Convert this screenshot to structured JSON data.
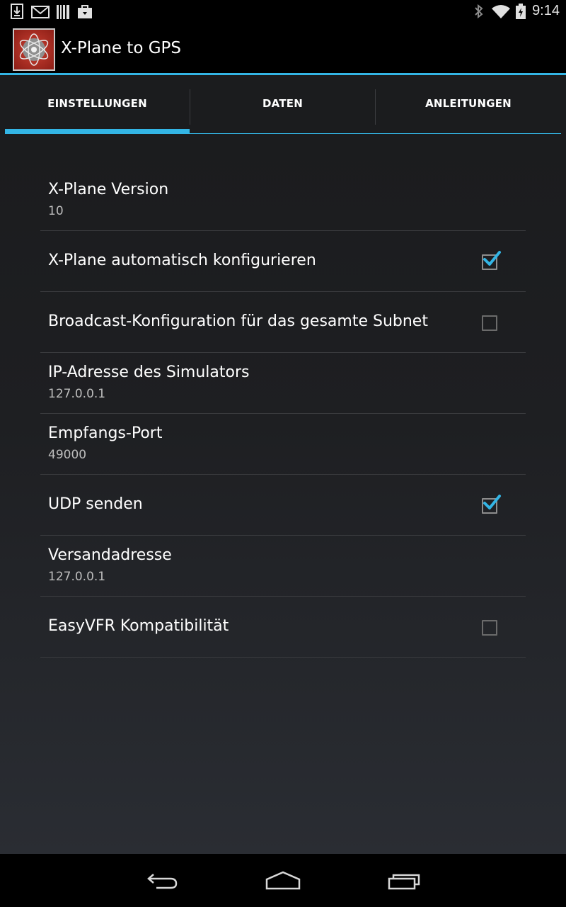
{
  "status_bar": {
    "time": "9:14",
    "left_icons": [
      "download-icon",
      "gmail-icon",
      "barcode-icon",
      "shopping-bag-icon"
    ],
    "right_icons": [
      "bluetooth-icon",
      "wifi-icon",
      "battery-icon"
    ]
  },
  "action_bar": {
    "title": "X-Plane to GPS"
  },
  "tabs": [
    {
      "label": "EINSTELLUNGEN",
      "selected": true
    },
    {
      "label": "DATEN",
      "selected": false
    },
    {
      "label": "ANLEITUNGEN",
      "selected": false
    }
  ],
  "preferences": [
    {
      "title": "X-Plane Version",
      "summary": "10"
    },
    {
      "title": "X-Plane automatisch konfigurieren",
      "checked": true
    },
    {
      "title": "Broadcast-Konfiguration für das gesamte Subnet",
      "checked": false
    },
    {
      "title": "IP-Adresse des Simulators",
      "summary": "127.0.0.1"
    },
    {
      "title": "Empfangs-Port",
      "summary": "49000"
    },
    {
      "title": "UDP senden",
      "checked": true
    },
    {
      "title": "Versandadresse",
      "summary": "127.0.0.1"
    },
    {
      "title": "EasyVFR Kompatibilität",
      "checked": false
    }
  ],
  "nav_bar": {
    "buttons": [
      "back-icon",
      "home-icon",
      "recent-apps-icon"
    ]
  },
  "colors": {
    "accent": "#33b5e5",
    "background": "#1b1c1e",
    "divider": "#3a3b3e"
  }
}
